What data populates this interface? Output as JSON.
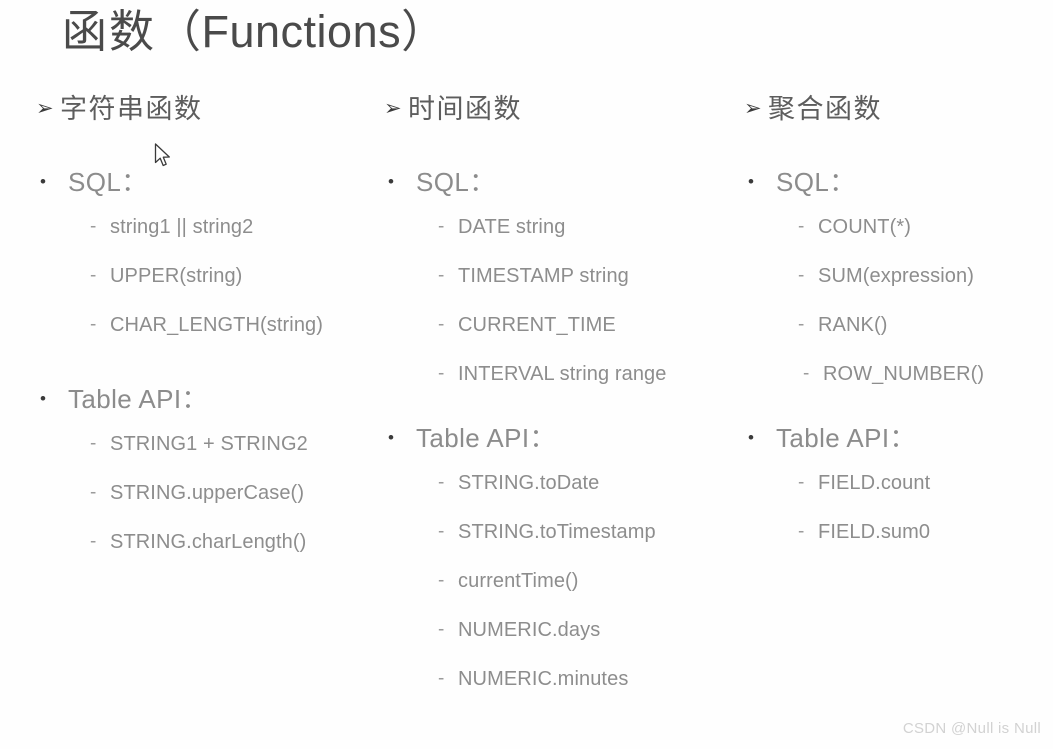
{
  "slide": {
    "title_cn": "函数",
    "title_en": "（Functions）",
    "title_full": "函数 （Functions）",
    "watermark": "CSDN @Null is Null",
    "background_color": "#ffffff",
    "title_color": "#4a4a4a",
    "heading_color": "#5d5d5d",
    "body_color": "#8c8c8c"
  },
  "bullets": {
    "arrow": "➢",
    "dot": "•",
    "dash": "-"
  },
  "columns": [
    {
      "heading": "字符串函数",
      "groups": [
        {
          "label": "SQL：",
          "items": [
            "string1 || string2",
            "UPPER(string)",
            "CHAR_LENGTH(string)"
          ]
        },
        {
          "label": "Table API：",
          "items": [
            "STRING1 + STRING2",
            "STRING.upperCase()",
            "STRING.charLength()"
          ]
        }
      ]
    },
    {
      "heading": "时间函数",
      "groups": [
        {
          "label": "SQL：",
          "items": [
            "DATE string",
            "TIMESTAMP string",
            "CURRENT_TIME",
            "INTERVAL string range"
          ]
        },
        {
          "label": "Table API：",
          "items": [
            "STRING.toDate",
            "STRING.toTimestamp",
            "currentTime()",
            "NUMERIC.days",
            "NUMERIC.minutes"
          ]
        }
      ]
    },
    {
      "heading": "聚合函数",
      "groups": [
        {
          "label": "SQL：",
          "items": [
            "COUNT(*)",
            "SUM(expression)",
            "RANK()",
            "ROW_NUMBER()"
          ]
        },
        {
          "label": "Table API：",
          "items": [
            "FIELD.count",
            "FIELD.sum0"
          ]
        }
      ]
    }
  ]
}
